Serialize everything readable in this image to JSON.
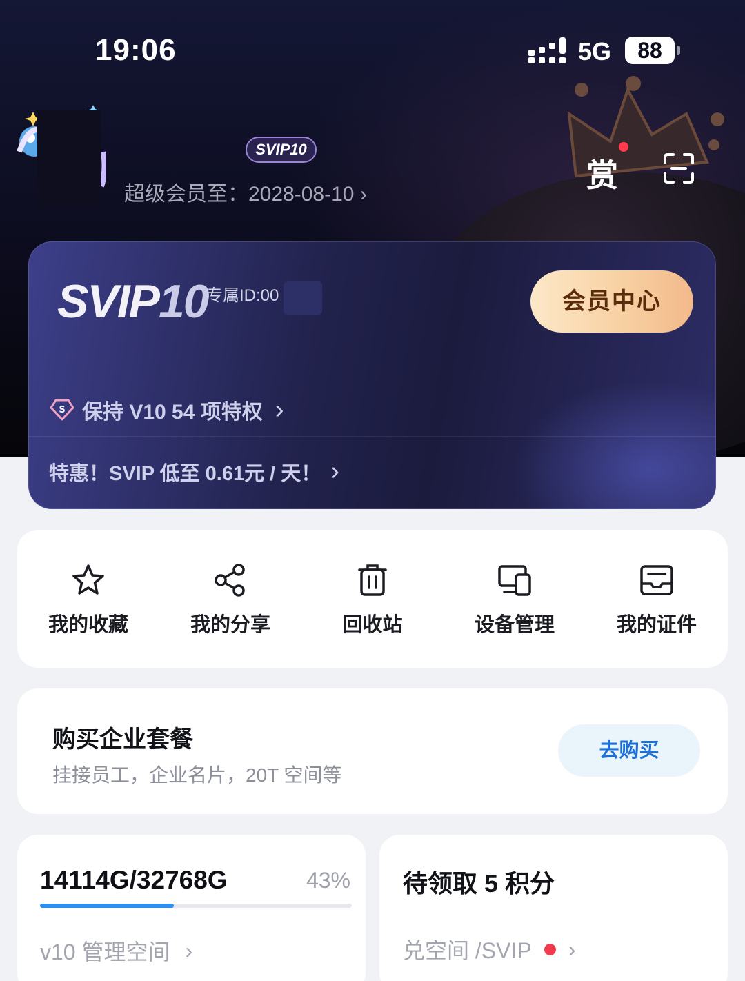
{
  "status_bar": {
    "time": "19:06",
    "network": "5G",
    "battery": "88"
  },
  "profile": {
    "badge": "SVIP10",
    "member_until": "超级会员至：2028-08-10",
    "reward_label": "赏"
  },
  "vip_card": {
    "logo_text": "SVIP",
    "logo_level": "10",
    "exclusive_id": "专属ID:00",
    "member_center_label": "会员中心",
    "privilege_text": "保持 V10 54 项特权",
    "promo_text": "特惠！SVIP 低至 0.61元 / 天！"
  },
  "quick_actions": [
    {
      "label": "我的收藏",
      "icon": "star-icon"
    },
    {
      "label": "我的分享",
      "icon": "share-icon"
    },
    {
      "label": "回收站",
      "icon": "trash-icon"
    },
    {
      "label": "设备管理",
      "icon": "devices-icon"
    },
    {
      "label": "我的证件",
      "icon": "id-card-icon"
    }
  ],
  "enterprise": {
    "title": "购买企业套餐",
    "subtitle": "挂接员工，企业名片，20T 空间等",
    "button_label": "去购买"
  },
  "storage": {
    "used": "14114G/32768G",
    "percent_label": "43%",
    "percent": 43,
    "link_label": "v10 管理空间"
  },
  "points": {
    "title": "待领取 5 积分",
    "link_label": "兑空间 /SVIP"
  },
  "colors": {
    "accent_blue": "#2c8ff0",
    "member_button": "#f7cfa0",
    "notification_red": "#f03a4d"
  }
}
